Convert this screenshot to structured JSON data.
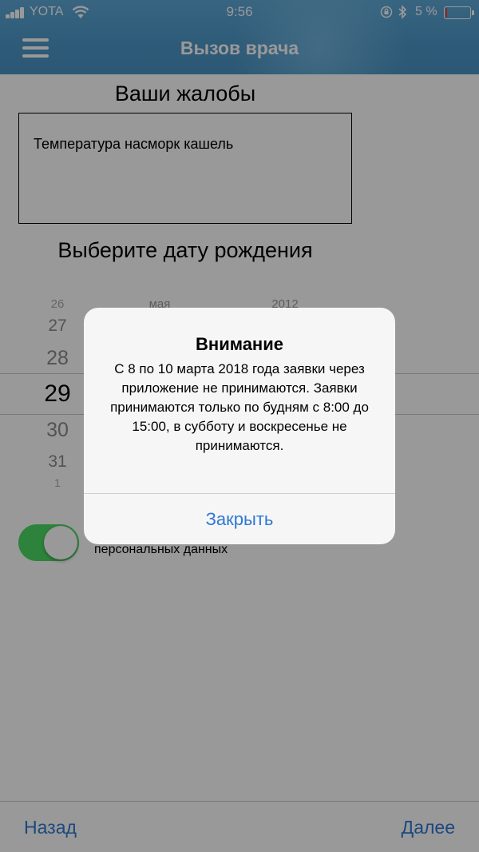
{
  "status_bar": {
    "carrier": "YOTA",
    "time": "9:56",
    "battery_percent": "5 %",
    "battery_level": 0.05,
    "icons": [
      "signal-icon",
      "wifi-icon",
      "orientation-lock-icon",
      "bluetooth-icon",
      "battery-icon"
    ]
  },
  "nav": {
    "title": "Вызов врача",
    "menu_icon": "hamburger-menu-icon"
  },
  "form": {
    "complaints_title": "Ваши жалобы",
    "complaints_value": "Температура насморк кашель",
    "birthdate_title": "Выберите дату рождения",
    "picker": {
      "days": [
        "26",
        "27",
        "28",
        "29",
        "30",
        "31",
        "1"
      ],
      "selected_day": "29",
      "month_visible": "мая",
      "year_visible": "2012"
    },
    "consent_toggle_on": true,
    "consent_text": "персональных данных"
  },
  "bottom_bar": {
    "back_label": "Назад",
    "next_label": "Далее"
  },
  "alert": {
    "title": "Внимание",
    "message": "С 8 по 10 марта 2018 года заявки через приложение не принимаются. Заявки принимаются только по будням с 8:00 до 15:00, в субботу и воскресенье не принимаются.",
    "close_label": "Закрыть"
  },
  "colors": {
    "header": "#4d98c9",
    "accent": "#2f78d4",
    "toggle_on": "#4cd964",
    "battery_low": "#ff3b30"
  }
}
